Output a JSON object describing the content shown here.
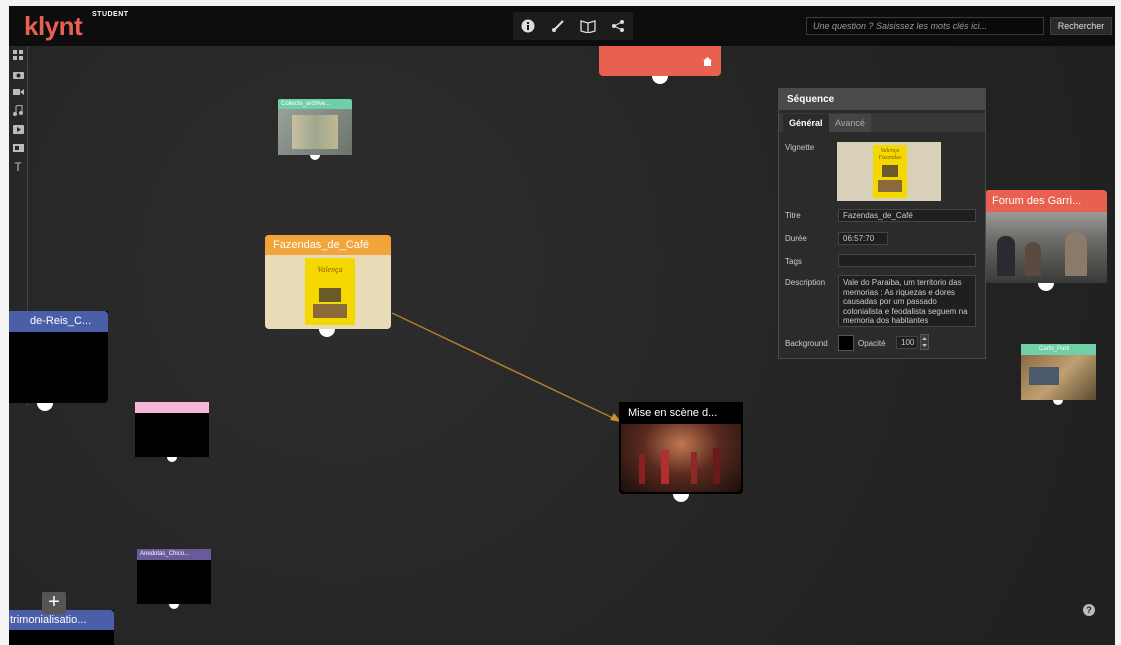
{
  "app": {
    "logo": "klynt",
    "logo_badge": "STUDENT",
    "toolbar_icons": [
      "info-icon",
      "brush-icon",
      "book-icon",
      "share-icon"
    ],
    "search_placeholder": "Une question ? Saisissez les mots clés ici...",
    "search_button": "Rechercher"
  },
  "left_tools": [
    "grid-icon",
    "camera-icon",
    "video-camera-icon",
    "music-icon",
    "play-icon",
    "image-icon",
    "text-icon"
  ],
  "nodes": {
    "collecte": {
      "title": "Collecte_archive...",
      "color": "#6fcfa8"
    },
    "fazendas": {
      "title": "Fazendas_de_Café",
      "color": "#f0a43a"
    },
    "reis": {
      "title": "de-Reis_C...",
      "color": "#4a5fa8"
    },
    "pink": {
      "title": "",
      "color": "#f6b8d8"
    },
    "anedotas": {
      "title": "Anedotas_Chico...",
      "color": "#6a5a9a"
    },
    "patrimonial": {
      "title": "trimonialisatio...",
      "color": "#4a5fa8"
    },
    "mise": {
      "title": "Mise en scène d..."
    },
    "forum": {
      "title": "Forum des Garri...",
      "color": "#e8604f"
    },
    "carto": {
      "title": "Carto_Parti",
      "color": "#6fcfa8"
    },
    "top_red": {
      "color": "#e8604f"
    }
  },
  "panel": {
    "title": "Séquence",
    "tab_general": "Général",
    "tab_avance": "Avancé",
    "vignette_label": "Vignette",
    "thumb_text_1": "Valença",
    "thumb_text_2": "Fazendas",
    "titre_label": "Titre",
    "titre_value": "Fazendas_de_Café",
    "duree_label": "Durée",
    "duree_value": "06:57:70",
    "tags_label": "Tags",
    "tags_value": "",
    "description_label": "Description",
    "description_value": "Vale do Paraiba, um territorio das memorias : As riquezas e dores causadas por um passado colonialista e feodalista seguem na memoria dos habitantes",
    "background_label": "Background",
    "opacity_label": "Opacité",
    "opacity_value": "100"
  },
  "misc": {
    "add_label": "+",
    "help_label": "?"
  }
}
